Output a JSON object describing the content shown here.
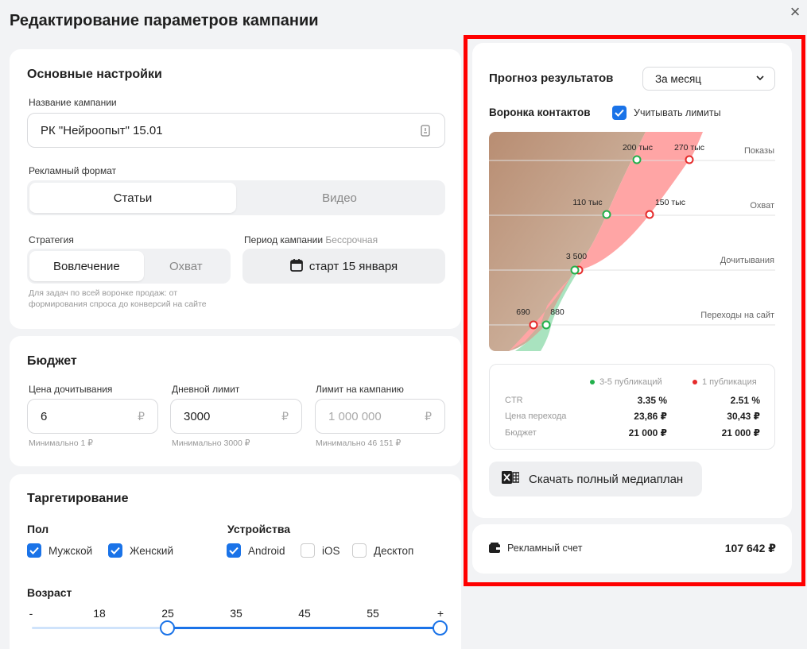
{
  "dialog": {
    "title": "Редактирование параметров кампании",
    "close_label": "×"
  },
  "main_settings": {
    "heading": "Основные настройки",
    "campaign_name_label": "Название кампании",
    "campaign_name_value": "РК \"Нейроопыт\" 15.01",
    "format_label": "Рекламный формат",
    "format_options": [
      "Статьи",
      "Видео"
    ],
    "format_selected": "Статьи",
    "strategy_label": "Стратегия",
    "strategy_options": [
      "Вовлечение",
      "Охват"
    ],
    "strategy_selected": "Вовлечение",
    "strategy_hint": "Для задач по всей воронке продаж: от формирования спроса до конверсий на сайте",
    "period_label": "Период кампании",
    "period_note": "Бессрочная",
    "period_button": "старт 15 января"
  },
  "budget": {
    "heading": "Бюджет",
    "fields": [
      {
        "label": "Цена дочитывания",
        "value": "6",
        "placeholder": "",
        "currency": "₽",
        "hint": "Минимально 1 ₽"
      },
      {
        "label": "Дневной лимит",
        "value": "3000",
        "placeholder": "",
        "currency": "₽",
        "hint": "Минимально 3000 ₽"
      },
      {
        "label": "Лимит на кампанию",
        "value": "",
        "placeholder": "1 000 000",
        "currency": "₽",
        "hint": "Минимально 46 151 ₽"
      }
    ]
  },
  "targeting": {
    "heading": "Таргетирование",
    "gender_label": "Пол",
    "gender_options": [
      {
        "label": "Мужской",
        "checked": true
      },
      {
        "label": "Женский",
        "checked": true
      }
    ],
    "devices_label": "Устройства",
    "device_options": [
      {
        "label": "Android",
        "checked": true
      },
      {
        "label": "iOS",
        "checked": false
      },
      {
        "label": "Десктоп",
        "checked": false
      }
    ],
    "age_label": "Возраст",
    "age_ticks": [
      "-",
      "18",
      "25",
      "35",
      "45",
      "55",
      "+"
    ],
    "age_range": [
      "25",
      "+"
    ]
  },
  "forecast": {
    "heading": "Прогноз результатов",
    "period_select": "За месяц",
    "funnel_label": "Воронка контактов",
    "limits_checkbox": "Учитывать лимиты",
    "limits_checked": true,
    "stages": [
      "Показы",
      "Охват",
      "Дочитывания",
      "Переходы на сайт"
    ],
    "series_multi": {
      "name": "3-5 публикаций",
      "color": "#22b04b",
      "labels": [
        "200 тыс",
        "110 тыс",
        "3 500",
        "880"
      ]
    },
    "series_single": {
      "name": "1 публикация",
      "color": "#e52b2b",
      "labels": [
        "270 тыс",
        "150 тыс",
        "",
        "690"
      ]
    },
    "table": {
      "rows": [
        {
          "label": "CTR",
          "multi": "3.35 %",
          "single": "2.51 %"
        },
        {
          "label": "Цена перехода",
          "multi": "23,86 ₽",
          "single": "30,43 ₽"
        },
        {
          "label": "Бюджет",
          "multi": "21 000 ₽",
          "single": "21 000 ₽"
        }
      ]
    },
    "download_button": "Скачать полный медиаплан"
  },
  "account": {
    "label": "Рекламный счет",
    "amount": "107 642 ₽"
  },
  "colors": {
    "accent": "#1a73e8",
    "highlight_frame": "#ff0000"
  }
}
